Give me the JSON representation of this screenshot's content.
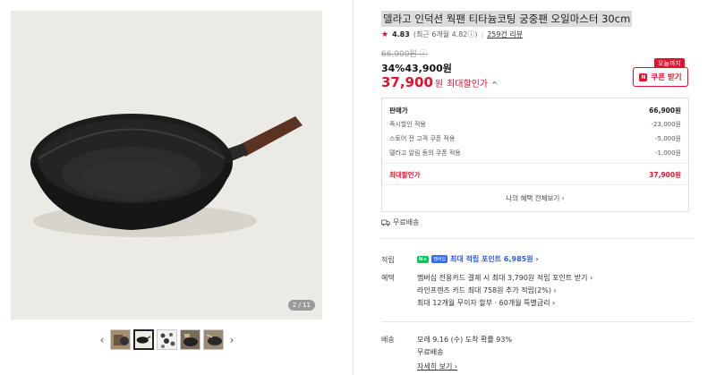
{
  "gallery": {
    "counter": "2 / 11",
    "prev": "‹",
    "next": "›"
  },
  "product": {
    "title": "델라고 인덕션 웍팬 티타늄코팅 궁중팬 오일마스터 30cm",
    "rating": "4.83",
    "rating_sub": "(최근 6개월 4.82ⓘ)",
    "reviews": "259건 리뷰",
    "original_price": "66,900원 ⓘ",
    "sale_price": "34%43,900원",
    "best_price": "37,900",
    "best_price_unit": "원",
    "best_price_label": "최대할인가",
    "best_price_chevron": "^",
    "coupon_tag": "오늘까지",
    "coupon_button": "쿠폰 받기",
    "coupon_n": "N"
  },
  "breakdown": {
    "rows": [
      {
        "label": "판매가",
        "value": "66,900원"
      },
      {
        "label": "즉시할인 적용",
        "value": "-23,000원"
      },
      {
        "label": "스토어 전 고객 쿠폰 적용",
        "value": "-5,000원"
      },
      {
        "label": "델라고 알림 동의 쿠폰 적용",
        "value": "-1,000원"
      }
    ],
    "total_label": "최대할인가",
    "total_value": "37,900원",
    "more": "나의 혜택 전체보기 ›"
  },
  "shipping_note": "무료배송",
  "shipping_icon": "truck-icon",
  "benefits": {
    "points_label": "적립",
    "points_text": "최대 적립 포인트 6,985원 ›",
    "points_badge": "N+",
    "points_member": "멤버십",
    "benefit_label": "혜택",
    "benefit_lines": [
      "멤버십 전용카드 결제 시 최대 3,790원 적립 포인트 받기 ›",
      "라인프렌즈 카드 최대 758원 추가 적립(2%) ›",
      "최대 12개월 무이자 할부 · 60개월 특별금리 ›"
    ]
  },
  "delivery": {
    "label": "배송",
    "lines": [
      "모레 9.16 (수) 도착 확률 93%",
      "무료배송"
    ],
    "detail": "자세히 보기 ›"
  },
  "colors": {
    "accent": "#e8112d",
    "point_blue": "#2f5ce0",
    "naver_green": "#03c75a"
  }
}
